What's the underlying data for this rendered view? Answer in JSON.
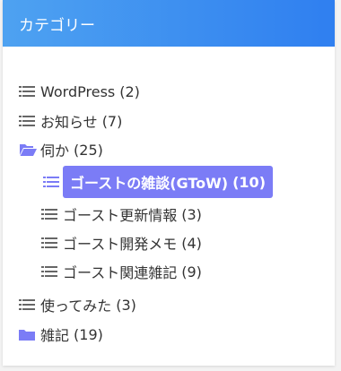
{
  "widget": {
    "title": "カテゴリー"
  },
  "colors": {
    "header_start": "#4ea2f1",
    "header_end": "#2f7ff0",
    "icon_gray": "#666666",
    "icon_accent": "#7b7cf6",
    "active_bg": "#7b7cf6",
    "text": "#333333"
  },
  "categories": [
    {
      "label": "WordPress",
      "count": "(2)",
      "icon": "list-icon"
    },
    {
      "label": "お知らせ",
      "count": "(7)",
      "icon": "list-icon"
    },
    {
      "label": "伺か",
      "count": "(25)",
      "icon": "folder-open-icon",
      "children": [
        {
          "label": "ゴーストの雑談(GToW)",
          "count": "(10)",
          "icon": "list-icon",
          "active": true
        },
        {
          "label": "ゴースト更新情報",
          "count": "(3)",
          "icon": "list-icon"
        },
        {
          "label": "ゴースト開発メモ",
          "count": "(4)",
          "icon": "list-icon"
        },
        {
          "label": "ゴースト関連雑記",
          "count": "(9)",
          "icon": "list-icon"
        }
      ]
    },
    {
      "label": "使ってみた",
      "count": "(3)",
      "icon": "list-icon"
    },
    {
      "label": "雑記",
      "count": "(19)",
      "icon": "folder-icon"
    }
  ]
}
